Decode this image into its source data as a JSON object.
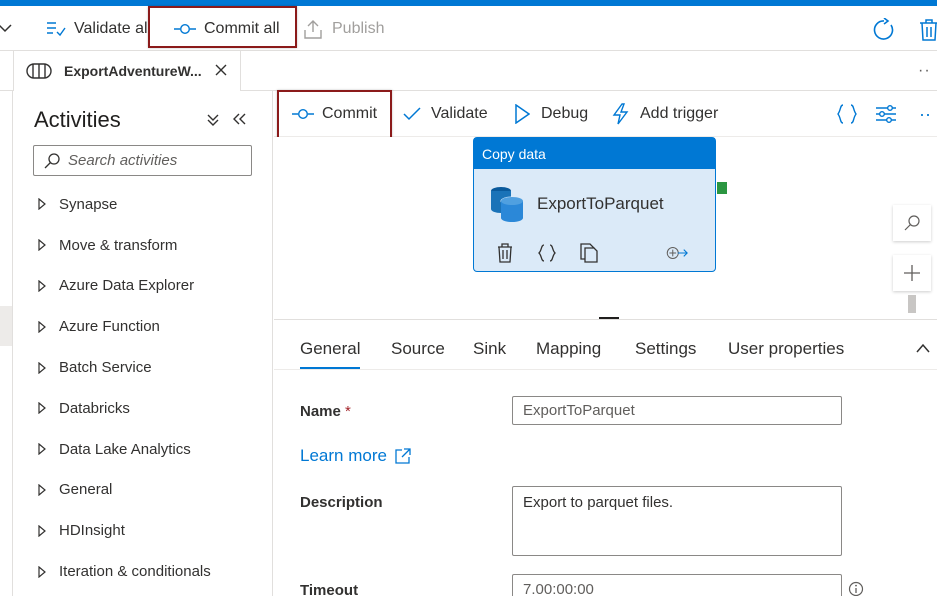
{
  "toolbar_top": {
    "validate_label": "Validate all",
    "commit_all_label": "Commit all",
    "publish_label": "Publish"
  },
  "tab": {
    "title": "ExportAdventureW..."
  },
  "activities": {
    "title": "Activities",
    "search_placeholder": "Search activities",
    "items": [
      {
        "label": "Synapse"
      },
      {
        "label": "Move & transform"
      },
      {
        "label": "Azure Data Explorer"
      },
      {
        "label": "Azure Function"
      },
      {
        "label": "Batch Service"
      },
      {
        "label": "Databricks"
      },
      {
        "label": "Data Lake Analytics"
      },
      {
        "label": "General"
      },
      {
        "label": "HDInsight"
      },
      {
        "label": "Iteration & conditionals"
      }
    ]
  },
  "pipeline_toolbar": {
    "commit_label": "Commit",
    "validate_label": "Validate",
    "debug_label": "Debug",
    "add_trigger_label": "Add trigger"
  },
  "node": {
    "type_label": "Copy data",
    "name": "ExportToParquet"
  },
  "properties": {
    "tabs": [
      {
        "label": "General",
        "active": true
      },
      {
        "label": "Source"
      },
      {
        "label": "Sink"
      },
      {
        "label": "Mapping"
      },
      {
        "label": "Settings"
      },
      {
        "label": "User properties"
      }
    ],
    "name_label": "Name",
    "required_mark": "*",
    "name_value": "ExportToParquet",
    "learn_more": "Learn more",
    "description_label": "Description",
    "description_value": "Export to parquet files.",
    "timeout_label": "Timeout",
    "timeout_value": "7.00:00:00"
  },
  "colors": {
    "accent": "#0078d4",
    "highlight_border": "#8b1a1a",
    "output_handle": "#2b9641"
  }
}
